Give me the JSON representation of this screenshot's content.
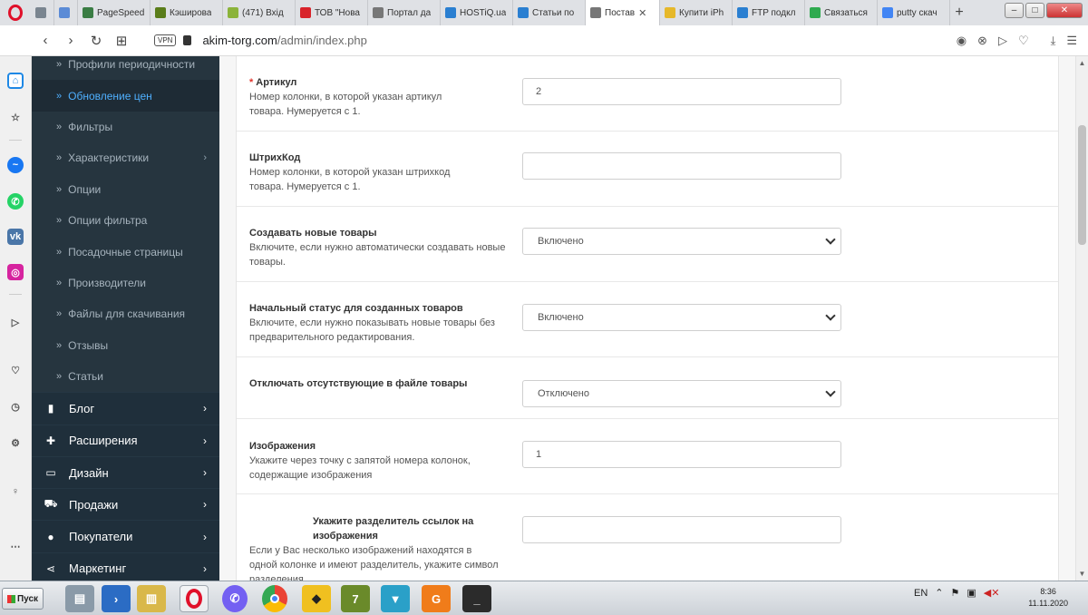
{
  "browser": {
    "tabs": [
      {
        "label": "",
        "icon": "settings-tab-icon",
        "color": "#7a8590"
      },
      {
        "label": "",
        "icon": "stack-tab-icon",
        "color": "#5b8bd6"
      },
      {
        "label": "PageSpeed",
        "icon": "code-icon",
        "color": "#3a7d44"
      },
      {
        "label": "Кэширова",
        "icon": "page-icon",
        "color": "#5a7d1a"
      },
      {
        "label": "(471) Вхід",
        "icon": "mail-icon",
        "color": "#8bb33a"
      },
      {
        "label": "ТОВ \"Нова",
        "icon": "nova-icon",
        "color": "#d8232a"
      },
      {
        "label": "Портал да",
        "icon": "doc-icon",
        "color": "#777777"
      },
      {
        "label": "HOSTiQ.ua",
        "icon": "iq-icon",
        "color": "#2a7fd1"
      },
      {
        "label": "Статьи по",
        "icon": "iq-icon",
        "color": "#2a7fd1"
      },
      {
        "label": "Постав",
        "icon": "doc-icon",
        "color": "#777777",
        "active": true
      },
      {
        "label": "Купити iPh",
        "icon": "hand-icon",
        "color": "#e6b82a"
      },
      {
        "label": "FTP подкл",
        "icon": "iq-icon",
        "color": "#2a7fd1"
      },
      {
        "label": "Связаться",
        "icon": "om-icon",
        "color": "#2eaa4f"
      },
      {
        "label": "putty скач",
        "icon": "google-icon",
        "color": "#4285f4"
      }
    ],
    "url_host": "akim-torg.com",
    "url_path": "/admin/index.php",
    "vpn_label": "VPN"
  },
  "admin_menu": {
    "subitems": [
      {
        "label": "Профили периодичности",
        "arrow": false
      },
      {
        "label": "Обновление цен",
        "active": true,
        "arrow": false
      },
      {
        "label": "Фильтры",
        "arrow": false
      },
      {
        "label": "Характеристики",
        "arrow": true
      },
      {
        "label": "Опции",
        "arrow": false
      },
      {
        "label": "Опции фильтра",
        "arrow": false
      },
      {
        "label": "Посадочные страницы",
        "arrow": false
      },
      {
        "label": "Производители",
        "arrow": false
      },
      {
        "label": "Файлы для скачивания",
        "arrow": false
      },
      {
        "label": "Отзывы",
        "arrow": false
      },
      {
        "label": "Статьи",
        "arrow": false
      }
    ],
    "items": [
      {
        "label": "Блог",
        "icon": "book-icon"
      },
      {
        "label": "Расширения",
        "icon": "puzzle-icon"
      },
      {
        "label": "Дизайн",
        "icon": "monitor-icon"
      },
      {
        "label": "Продажи",
        "icon": "cart-icon"
      },
      {
        "label": "Покупатели",
        "icon": "user-icon"
      },
      {
        "label": "Маркетинг",
        "icon": "share-icon"
      }
    ]
  },
  "form": {
    "article": {
      "required_mark": "*",
      "label": "Артикул",
      "help": "Номер колонки, в которой указан артикул товара. Нумеруется с 1.",
      "value": "2"
    },
    "barcode": {
      "label": "ШтрихКод",
      "help": "Номер колонки, в которой указан штрихкод товара. Нумеруется с 1.",
      "value": ""
    },
    "create_new": {
      "label": "Создавать новые товары",
      "help": "Включите, если нужно автоматически создавать новые товары.",
      "selected": "Включено"
    },
    "initial_status": {
      "label": "Начальный статус для созданных товаров",
      "help": "Включите, если нужно показывать новые товары без предварительного редактирования.",
      "selected": "Включено"
    },
    "disable_missing": {
      "label": "Отключать отсутствующие в файле товары",
      "selected": "Отключено"
    },
    "images": {
      "label": "Изображения",
      "help": "Укажите через точку с запятой номера колонок, содержащие изображения",
      "value": "1"
    },
    "separator": {
      "label": "Укажите разделитель ссылок на изображения",
      "help": "Если у Вас несколько изображений находятся в одной колонке и имеют разделитель, укажите символ разделения",
      "value": ""
    }
  },
  "taskbar": {
    "start_label": "Пуск",
    "language": "EN",
    "time": "8:36",
    "date": "11.11.2020"
  }
}
